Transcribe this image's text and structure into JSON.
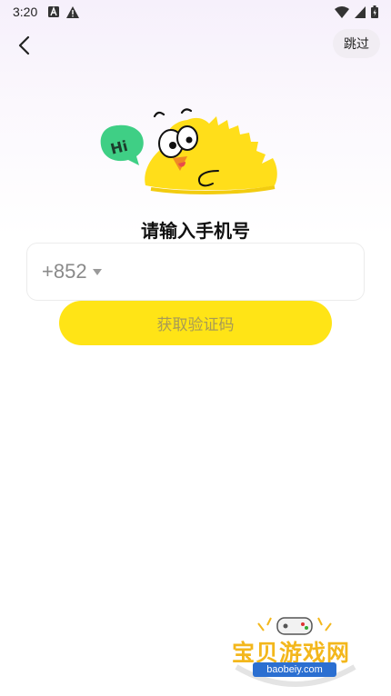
{
  "status_bar": {
    "time": "3:20",
    "left_icons": [
      "font-icon",
      "alert-icon"
    ],
    "right_icons": [
      "wifi-icon",
      "signal-icon",
      "battery-icon"
    ]
  },
  "header": {
    "back_icon": "chevron-left-icon",
    "skip_label": "跳过"
  },
  "mascot": {
    "bubble_text": "Hi"
  },
  "login": {
    "title": "请输入手机号",
    "country_code": "+852",
    "phone_value": "",
    "phone_placeholder": "",
    "get_code_label": "获取验证码"
  },
  "watermark": {
    "text": "宝贝游戏网",
    "url": "baobeiy.com"
  },
  "colors": {
    "accent_yellow": "#ffe416",
    "button_text": "#a79a56",
    "bubble_green": "#3fcf85",
    "mascot_yellow": "#ffde1a"
  }
}
